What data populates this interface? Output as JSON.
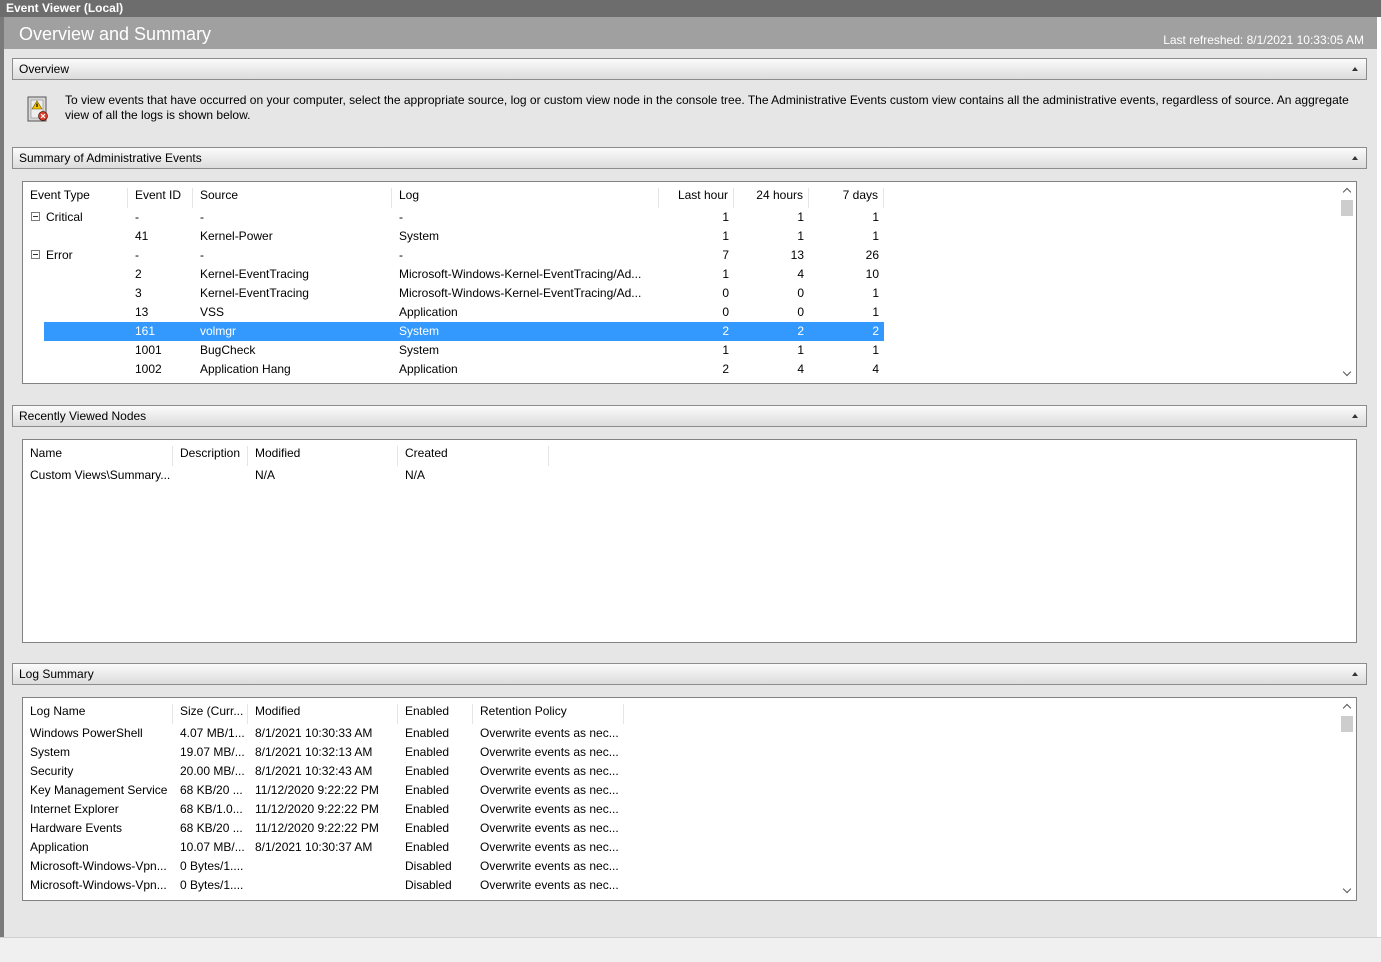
{
  "window": {
    "title": "Event Viewer (Local)"
  },
  "header": {
    "title": "Overview and Summary",
    "last_refreshed": "Last refreshed: 8/1/2021 10:33:05 AM"
  },
  "overview": {
    "label": "Overview",
    "text_line1": "To view events that have occurred on your computer, select the appropriate source, log or custom view node in the console tree. The Administrative Events custom view contains all the administrative events, regardless of source. An aggregate",
    "text_line2": "view of all the logs is shown below."
  },
  "admin_events": {
    "label": "Summary of Administrative Events",
    "columns": [
      "Event Type",
      "Event ID",
      "Source",
      "Log",
      "Last hour",
      "24 hours",
      "7 days"
    ],
    "rows": [
      [
        "Critical",
        "-",
        "-",
        "-",
        "1",
        "1",
        "1"
      ],
      [
        "",
        "41",
        "Kernel-Power",
        "System",
        "1",
        "1",
        "1"
      ],
      [
        "Error",
        "-",
        "-",
        "-",
        "7",
        "13",
        "26"
      ],
      [
        "",
        "2",
        "Kernel-EventTracing",
        "Microsoft-Windows-Kernel-EventTracing/Ad...",
        "1",
        "4",
        "10"
      ],
      [
        "",
        "3",
        "Kernel-EventTracing",
        "Microsoft-Windows-Kernel-EventTracing/Ad...",
        "0",
        "0",
        "1"
      ],
      [
        "",
        "13",
        "VSS",
        "Application",
        "0",
        "0",
        "1"
      ],
      [
        "",
        "161",
        "volmgr",
        "System",
        "2",
        "2",
        "2"
      ],
      [
        "",
        "1001",
        "BugCheck",
        "System",
        "1",
        "1",
        "1"
      ],
      [
        "",
        "1002",
        "Application Hang",
        "Application",
        "2",
        "4",
        "4"
      ]
    ]
  },
  "recent_nodes": {
    "label": "Recently Viewed Nodes",
    "columns": [
      "Name",
      "Description",
      "Modified",
      "Created"
    ],
    "rows": [
      [
        "Custom Views\\Summary...",
        "",
        "N/A",
        "N/A"
      ]
    ]
  },
  "log_summary": {
    "label": "Log Summary",
    "columns": [
      "Log Name",
      "Size (Curr...",
      "Modified",
      "Enabled",
      "Retention Policy"
    ],
    "rows": [
      [
        "Windows PowerShell",
        "4.07 MB/1...",
        "8/1/2021 10:30:33 AM",
        "Enabled",
        "Overwrite events as nec..."
      ],
      [
        "System",
        "19.07 MB/...",
        "8/1/2021 10:32:13 AM",
        "Enabled",
        "Overwrite events as nec..."
      ],
      [
        "Security",
        "20.00 MB/...",
        "8/1/2021 10:32:43 AM",
        "Enabled",
        "Overwrite events as nec..."
      ],
      [
        "Key Management Service",
        "68 KB/20 ...",
        "11/12/2020 9:22:22 PM",
        "Enabled",
        "Overwrite events as nec..."
      ],
      [
        "Internet Explorer",
        "68 KB/1.0...",
        "11/12/2020 9:22:22 PM",
        "Enabled",
        "Overwrite events as nec..."
      ],
      [
        "Hardware Events",
        "68 KB/20 ...",
        "11/12/2020 9:22:22 PM",
        "Enabled",
        "Overwrite events as nec..."
      ],
      [
        "Application",
        "10.07 MB/...",
        "8/1/2021 10:30:37 AM",
        "Enabled",
        "Overwrite events as nec..."
      ],
      [
        "Microsoft-Windows-Vpn...",
        "0 Bytes/1....",
        "",
        "Disabled",
        "Overwrite events as nec..."
      ],
      [
        "Microsoft-Windows-Vpn...",
        "0 Bytes/1....",
        "",
        "Disabled",
        "Overwrite events as nec..."
      ]
    ]
  },
  "colors": {
    "selection": "#3399ff",
    "header_bg": "#a0a0a0",
    "titlebar_bg": "#6d6d6d",
    "content_bg": "#e6e6e6"
  }
}
